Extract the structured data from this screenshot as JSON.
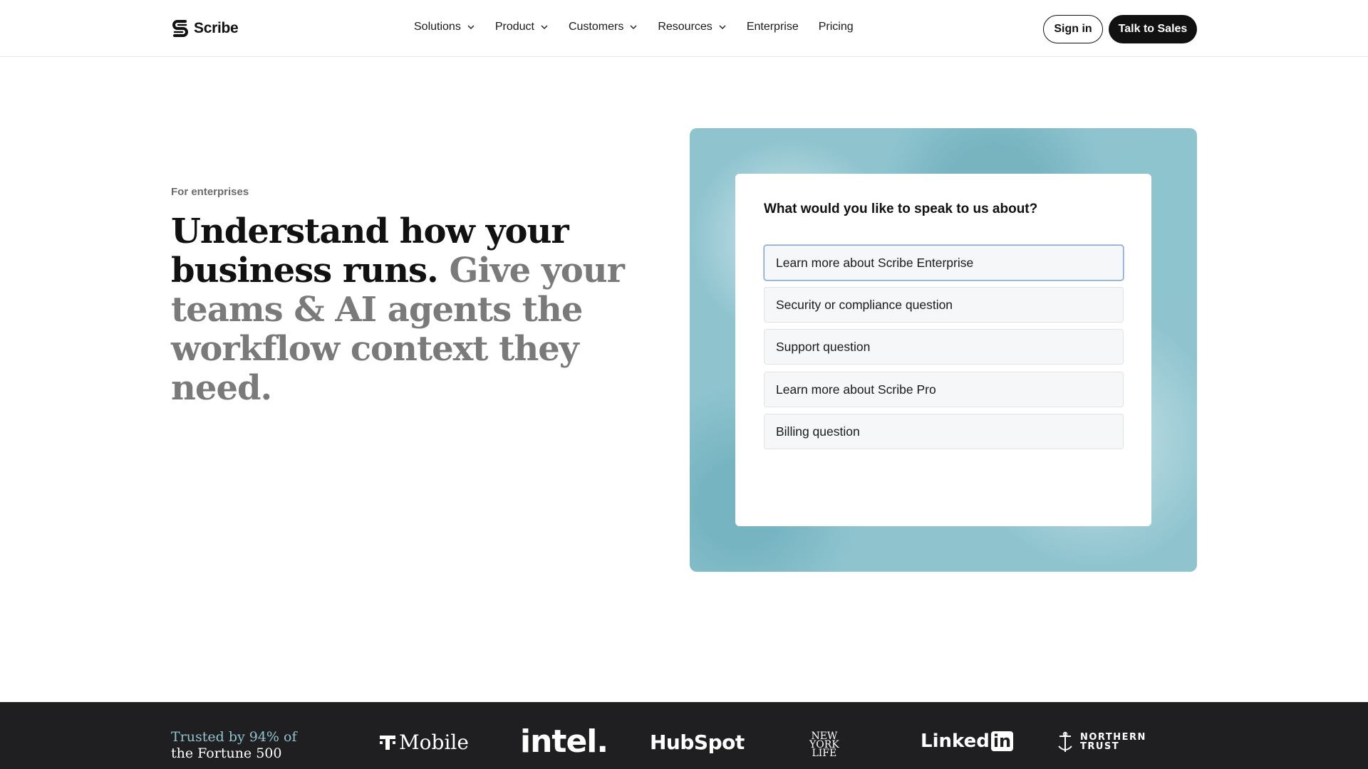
{
  "brand": {
    "name": "Scribe",
    "logo_icon": "scribe-logo-icon"
  },
  "nav": {
    "items": [
      {
        "label": "Solutions",
        "has_dropdown": true
      },
      {
        "label": "Product",
        "has_dropdown": true
      },
      {
        "label": "Customers",
        "has_dropdown": true
      },
      {
        "label": "Resources",
        "has_dropdown": true
      },
      {
        "label": "Enterprise",
        "has_dropdown": false
      },
      {
        "label": "Pricing",
        "has_dropdown": false
      }
    ],
    "sign_in": "Sign in",
    "talk_to_sales": "Talk to Sales"
  },
  "hero": {
    "eyebrow": "For enterprises",
    "headline_dark": "Understand how your business runs.",
    "headline_muted": "Give your teams & AI agents the workflow context they need."
  },
  "contact_card": {
    "question": "What would you like to speak to us about?",
    "options": [
      {
        "label": "Learn more about Scribe Enterprise",
        "selected": true
      },
      {
        "label": "Security or compliance question",
        "selected": false
      },
      {
        "label": "Support question",
        "selected": false
      },
      {
        "label": "Learn more about Scribe Pro",
        "selected": false
      },
      {
        "label": "Billing question",
        "selected": false
      }
    ]
  },
  "trusted": {
    "line1": "Trusted by 94% of",
    "line2": "the Fortune 500",
    "logos": {
      "tmobile": "Mobile",
      "intel": "intel.",
      "hubspot": "HubSpot",
      "nyl_1": "NEW",
      "nyl_2": "YORK",
      "nyl_3": "LIFE",
      "linkedin_text": "Linked",
      "linkedin_box": "in",
      "northern_1": "NORTHERN",
      "northern_2": "TRUST"
    }
  },
  "colors": {
    "accent_teal": "#8fc4cf",
    "primary_dark": "#111111",
    "band_bg": "#1f1f21",
    "selected_border": "#7fa3d6"
  }
}
